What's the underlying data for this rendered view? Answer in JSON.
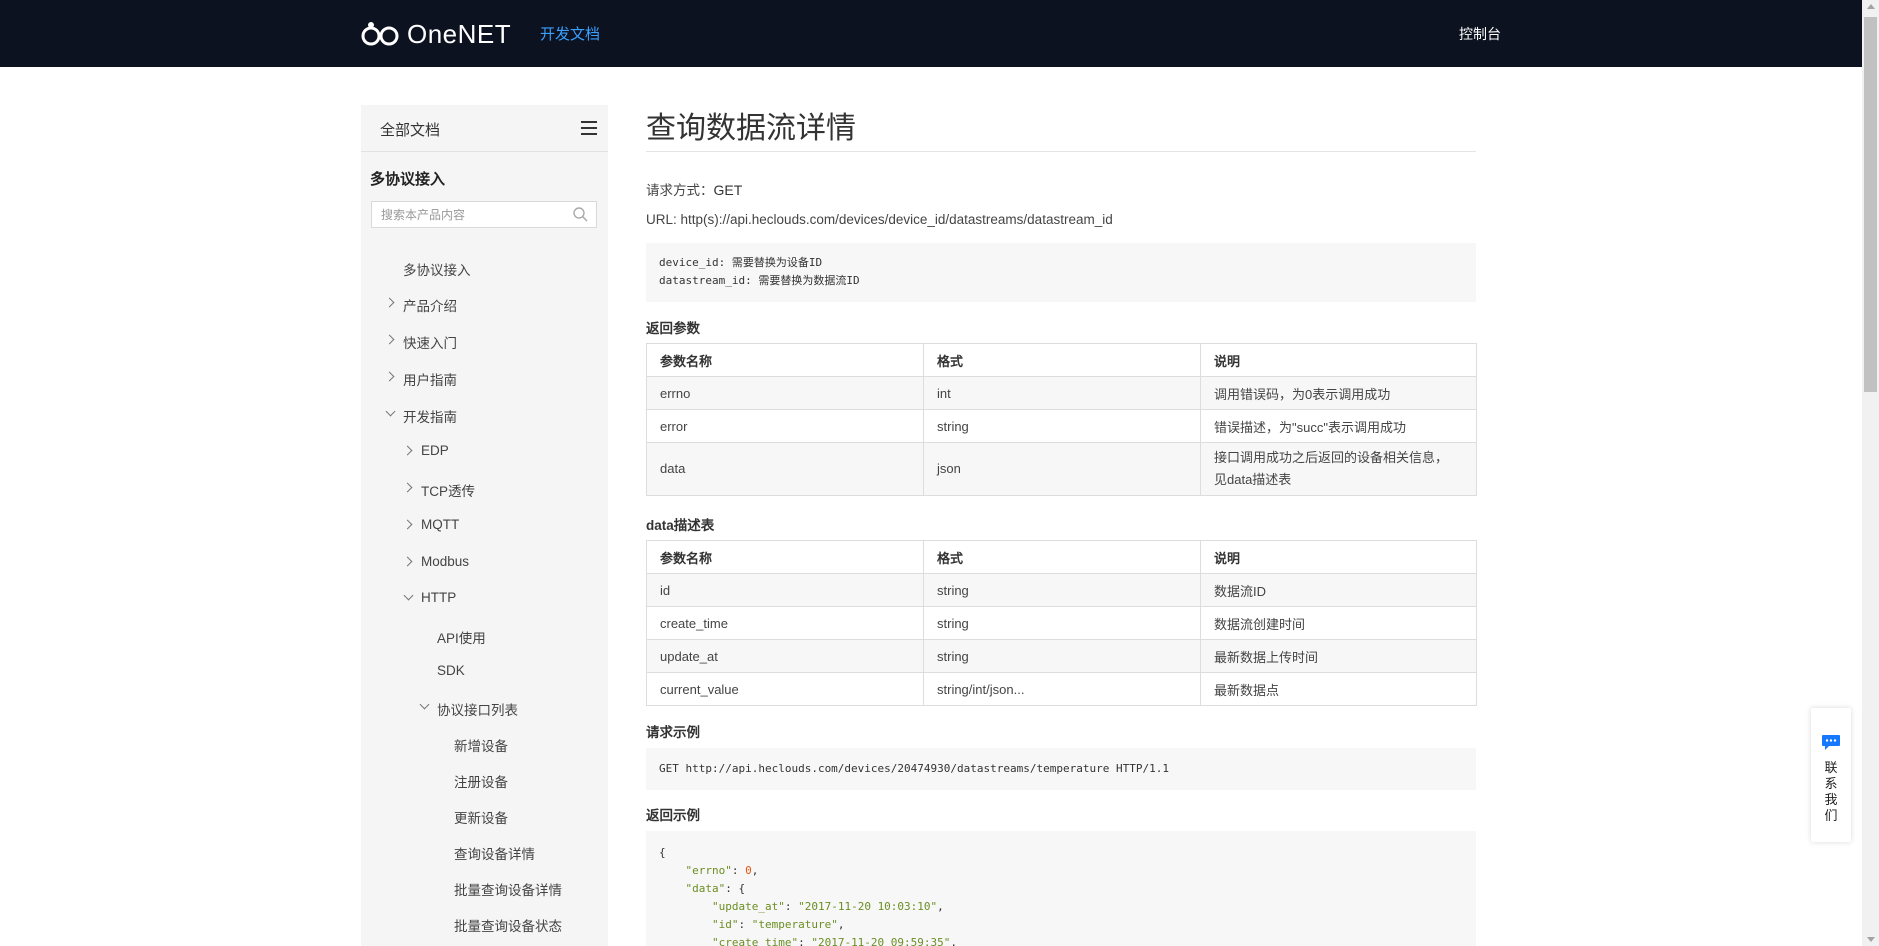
{
  "header": {
    "logo_text": "OneNET",
    "nav_docs": "开发文档",
    "nav_console": "控制台"
  },
  "sidebar": {
    "title": "全部文档",
    "section": "多协议接入",
    "search_placeholder": "搜索本产品内容",
    "items": [
      {
        "label": "多协议接入"
      },
      {
        "label": "产品介绍"
      },
      {
        "label": "快速入门"
      },
      {
        "label": "用户指南"
      },
      {
        "label": "开发指南"
      },
      {
        "label": "EDP"
      },
      {
        "label": "TCP透传"
      },
      {
        "label": "MQTT"
      },
      {
        "label": "Modbus"
      },
      {
        "label": "HTTP"
      },
      {
        "label": "API使用"
      },
      {
        "label": "SDK"
      },
      {
        "label": "协议接口列表"
      },
      {
        "label": "新增设备"
      },
      {
        "label": "注册设备"
      },
      {
        "label": "更新设备"
      },
      {
        "label": "查询设备详情"
      },
      {
        "label": "批量查询设备详情"
      },
      {
        "label": "批量查询设备状态"
      }
    ]
  },
  "main": {
    "title": "查询数据流详情",
    "method_label": "请求方式：",
    "method": "GET",
    "url": "URL: http(s)://api.heclouds.com/devices/device_id/datastreams/datastream_id",
    "params_code": [
      {
        "key": "device_id",
        "sep": ": ",
        "desc": "需要替换为设备ID"
      },
      {
        "key": "datastream_id",
        "sep": ": ",
        "desc": "需要替换为数据流ID"
      }
    ],
    "return_heading": "返回参数",
    "table_headers": [
      "参数名称",
      "格式",
      "说明"
    ],
    "return_rows": [
      [
        "errno",
        "int",
        "调用错误码，为0表示调用成功"
      ],
      [
        "error",
        "string",
        "错误描述，为\"succ\"表示调用成功"
      ],
      [
        "data",
        "json",
        "接口调用成功之后返回的设备相关信息，见data描述表"
      ]
    ],
    "data_heading": "data描述表",
    "data_rows": [
      [
        "id",
        "string",
        "数据流ID"
      ],
      [
        "create_time",
        "string",
        "数据流创建时间"
      ],
      [
        "update_at",
        "string",
        "最新数据上传时间"
      ],
      [
        "current_value",
        "string/int/json...",
        "最新数据点"
      ]
    ],
    "request_example_heading": "请求示例",
    "request_example": "GET http://api.heclouds.com/devices/20474930/datastreams/temperature HTTP/1.1",
    "response_example_heading": "返回示例",
    "response_lines": [
      {
        "indent": "",
        "parts": [
          [
            "p",
            "{"
          ]
        ]
      },
      {
        "indent": "    ",
        "parts": [
          [
            "k",
            "\"errno\""
          ],
          [
            "p",
            ": "
          ],
          [
            "n",
            "0"
          ],
          [
            "p",
            ","
          ]
        ]
      },
      {
        "indent": "    ",
        "parts": [
          [
            "k",
            "\"data\""
          ],
          [
            "p",
            ": {"
          ]
        ]
      },
      {
        "indent": "        ",
        "parts": [
          [
            "k",
            "\"update_at\""
          ],
          [
            "p",
            ": "
          ],
          [
            "s",
            "\"2017-11-20 10:03:10\""
          ],
          [
            "p",
            ","
          ]
        ]
      },
      {
        "indent": "        ",
        "parts": [
          [
            "k",
            "\"id\""
          ],
          [
            "p",
            ": "
          ],
          [
            "s",
            "\"temperature\""
          ],
          [
            "p",
            ","
          ]
        ]
      },
      {
        "indent": "        ",
        "parts": [
          [
            "k",
            "\"create_time\""
          ],
          [
            "p",
            ": "
          ],
          [
            "s",
            "\"2017-11-20 09:59:35\""
          ],
          [
            "p",
            ","
          ]
        ]
      }
    ]
  },
  "contact": {
    "label": "联系我们"
  }
}
